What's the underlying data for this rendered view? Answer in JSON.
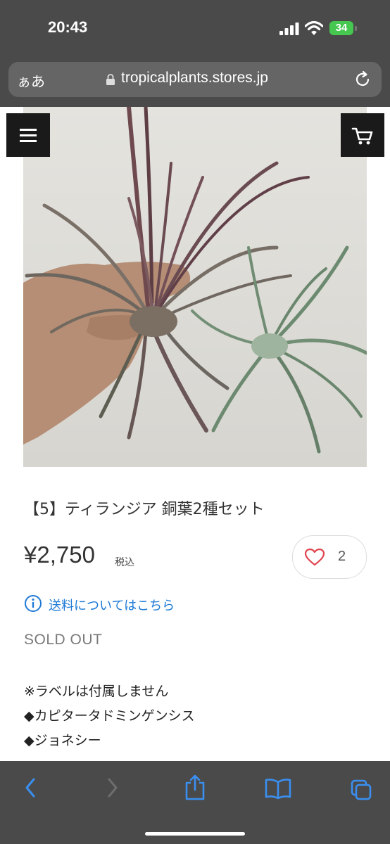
{
  "status_bar": {
    "time": "20:43",
    "battery": "34"
  },
  "browser": {
    "text_size_button": "ぁあ",
    "url": "tropicalplants.stores.jp"
  },
  "product": {
    "title": "【5】ティランジア 銅葉2種セット",
    "price": "¥2,750",
    "tax_label": "税込",
    "like_count": "2",
    "shipping_link": "送料についてはこちら",
    "status": "SOLD OUT",
    "description": [
      "※ラベルは付属しません",
      "◆カピタータドミンゲンシス",
      "◆ジョネシー"
    ]
  },
  "colors": {
    "accent": "#1f7ad6",
    "browser_chrome": "#4a4a4a",
    "heart": "#e0454f",
    "battery": "#45c750"
  },
  "icons": {
    "header": [
      "hamburger-menu-icon",
      "cart-icon"
    ],
    "toolbar": [
      "back-icon",
      "forward-icon",
      "share-icon",
      "bookmarks-icon",
      "tabs-icon"
    ]
  }
}
